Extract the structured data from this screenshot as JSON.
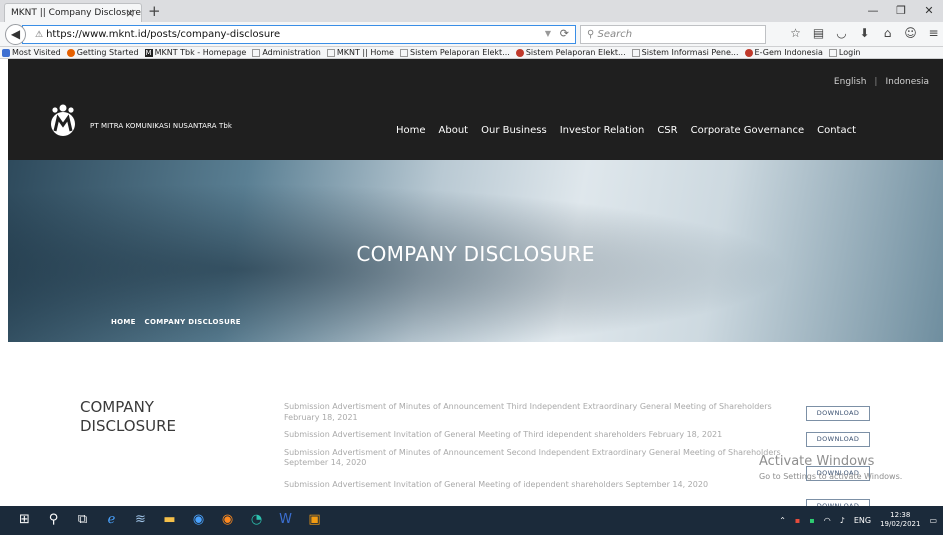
{
  "browser": {
    "tab_title": "MKNT || Company Disclosure",
    "tab_close": "×",
    "new_tab": "+",
    "url": "https://www.mknt.id/posts/company-disclosure",
    "search_placeholder": "Search",
    "bookmarks": [
      {
        "label": "Most Visited",
        "icon": "firefox-icon"
      },
      {
        "label": "Getting Started",
        "icon": "firefox-icon"
      },
      {
        "label": "MKNT Tbk - Homepage",
        "icon": "m-logo-icon"
      },
      {
        "label": "Administration",
        "icon": "page-icon"
      },
      {
        "label": "MKNT || Home",
        "icon": "page-icon"
      },
      {
        "label": "Sistem Pelaporan Elekt...",
        "icon": "page-icon"
      },
      {
        "label": "Sistem Pelaporan Elekt...",
        "icon": "idx-icon"
      },
      {
        "label": "Sistem Informasi Pene...",
        "icon": "page-icon"
      },
      {
        "label": "E-Gem Indonesia",
        "icon": "egem-icon"
      },
      {
        "label": "Login",
        "icon": "page-icon"
      }
    ]
  },
  "site": {
    "languages": [
      "English",
      "Indonesia"
    ],
    "brand": "PT MITRA KOMUNIKASI NUSANTARA Tbk",
    "menu": [
      "Home",
      "About",
      "Our Business",
      "Investor Relation",
      "CSR",
      "Corporate Governance",
      "Contact"
    ],
    "hero_title": "COMPANY DISCLOSURE",
    "breadcrumb": [
      "HOME",
      "COMPANY DISCLOSURE"
    ],
    "section_title": "COMPANY DISCLOSURE",
    "disclosures": [
      "Submission Advertisment of Minutes of Announcement Third Independent Extraordinary General Meeting of Shareholders February 18, 2021",
      "Submission Advertisement Invitation of General Meeting of Third idependent shareholders February 18, 2021",
      "Submission Advertisment of Minutes of Announcement Second Independent Extraordinary General Meeting of Shareholders September 14, 2020",
      "Submission Advertisement Invitation of General Meeting of idependent shareholders September 14, 2020"
    ],
    "download_label": "DOWNLOAD"
  },
  "os": {
    "watermark_title": "Activate Windows",
    "watermark_sub": "Go to Settings to activate Windows.",
    "language": "ENG",
    "time": "12:38",
    "date": "19/02/2021"
  },
  "colors": {
    "header_bg": "#1f1f1f",
    "button_border": "#7c90a6",
    "taskbar_bg": "#1b2a3a"
  }
}
